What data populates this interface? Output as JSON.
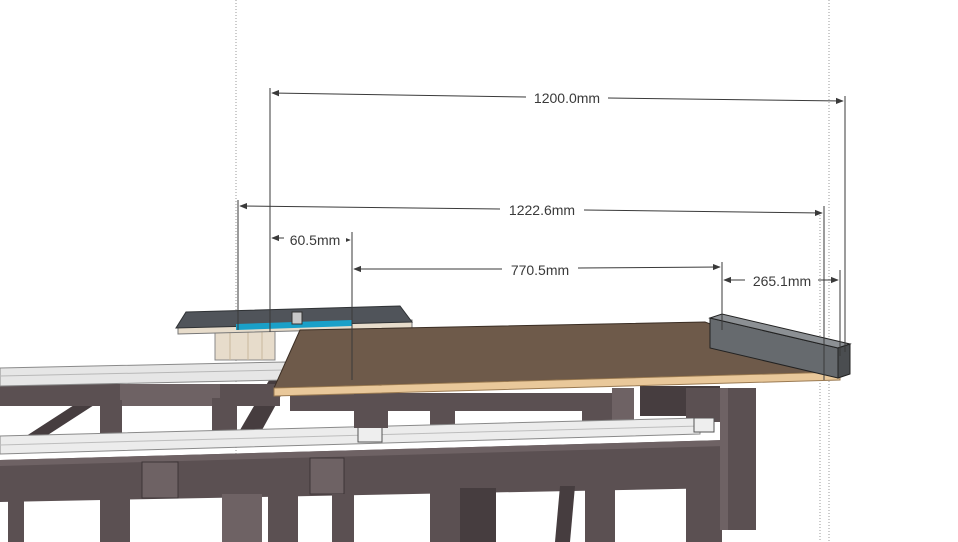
{
  "dimensions": {
    "overall_width": "1200.0mm",
    "total_span": "1222.6mm",
    "left_offset": "60.5mm",
    "middle_span": "770.5mm",
    "right_offset": "265.1mm"
  },
  "colors": {
    "frame": "#5b5052",
    "frame_dark": "#463d3f",
    "frame_light": "#6e6264",
    "rail": "#e6e6e6",
    "tabletop": "#6e5a4a",
    "tabletop_edge": "#e9c89a",
    "fence": "#666a6e",
    "saw_top": "#50545a",
    "saw_accent": "#1aa0c8",
    "plywood": "#e7dccb",
    "dimension_line": "#3a3a3a",
    "guide_line": "#9a9a9a"
  }
}
